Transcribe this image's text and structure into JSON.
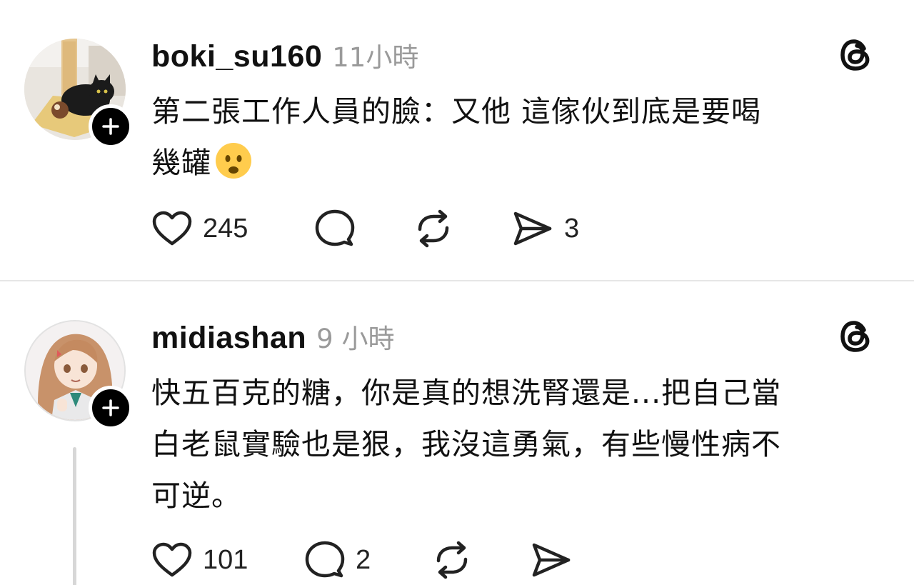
{
  "posts": [
    {
      "username": "boki_su160",
      "time": "11小時",
      "text": "第二張工作人員的臉：又他 這傢伙到底是要喝\n幾罐",
      "emoji": "frowning-face-emoji",
      "likes": "245",
      "replies": "",
      "reposts": "",
      "shares": "3",
      "avatar": "cat-avatar"
    },
    {
      "username": "midiashan",
      "time": "9 小時",
      "text": "快五百克的糖，你是真的想洗腎還是...把自己當\n白老鼠實驗也是狠，我沒這勇氣，有些慢性病不\n可逆。",
      "likes": "101",
      "replies": "2",
      "reposts": "",
      "shares": "",
      "avatar": "anime-girl-avatar"
    }
  ],
  "icons": {
    "like": "heart-icon",
    "reply": "comment-icon",
    "repost": "repost-icon",
    "share": "send-icon",
    "brand": "threads-logo-icon",
    "follow": "plus-icon"
  },
  "colors": {
    "text": "#111111",
    "muted": "#9a9a9a",
    "divider": "#e6e6e6",
    "thread_line": "#d7d7d7"
  }
}
